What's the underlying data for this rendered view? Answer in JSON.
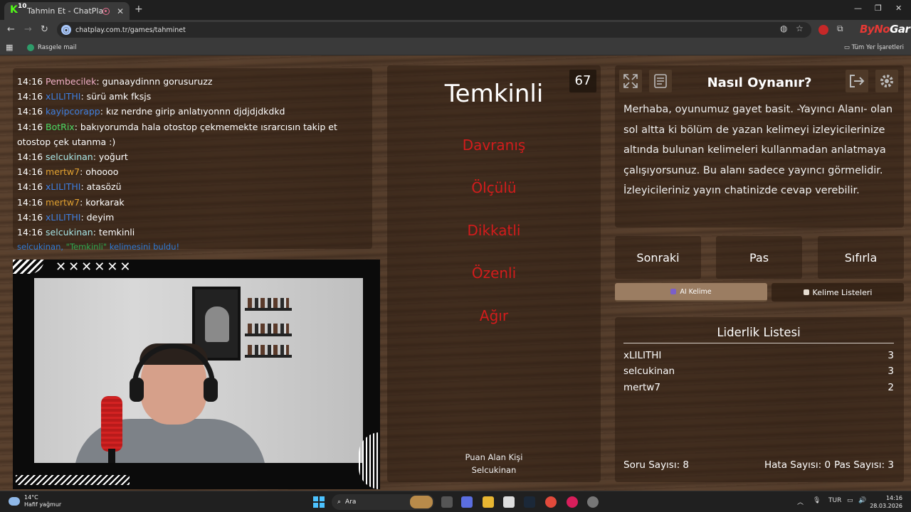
{
  "browser": {
    "tab_title": "Tahmin Et - ChatPlay",
    "tab_badge": "10",
    "url": "chatplay.com.tr/games/tahminet",
    "bookmark": "Rasgele mail",
    "all_bookmarks": "Tüm Yer İşaretleri",
    "brand_left": "ByNo",
    "brand_right": "Gar"
  },
  "chat": {
    "lines": [
      {
        "time": "14:16",
        "user": "Pembecilek",
        "color": "#f0b0c8",
        "text": ": gunaaydinnn gorusuruzz"
      },
      {
        "time": "14:16",
        "user": "xLILITHI",
        "color": "#3f7fe0",
        "text": ": sürü amk fksjs"
      },
      {
        "time": "14:16",
        "user": "kayipcorapp",
        "color": "#3f7fe0",
        "text": ": kız nerdne girip anlatıyonnn djdjdjdkdkd"
      },
      {
        "time": "14:16",
        "user": "BotRix",
        "color": "#4cd964",
        "text": ": bakıyorumda hala otostop çekmemekte ısrarcısın takip et otostop çek utanma :)"
      },
      {
        "time": "14:16",
        "user": "selcukinan",
        "color": "#a8e6e6",
        "text": ": yoğurt"
      },
      {
        "time": "14:16",
        "user": "mertw7",
        "color": "#e0a030",
        "text": ": ohoooo"
      },
      {
        "time": "14:16",
        "user": "xLILITHI",
        "color": "#3f7fe0",
        "text": ": atasözü"
      },
      {
        "time": "14:16",
        "user": "mertw7",
        "color": "#e0a030",
        "text": ": korkarak"
      },
      {
        "time": "14:16",
        "user": "xLILITHI",
        "color": "#3f7fe0",
        "text": ": deyim"
      },
      {
        "time": "14:16",
        "user": "selcukinan",
        "color": "#a8e6e6",
        "text": ": temkinli"
      }
    ],
    "system_prefix": "selcukinan, ",
    "system_word": "\"Temkinli\"",
    "system_suffix": " kelimesini buldu!"
  },
  "cam": {
    "overlay_marks": "✕✕✕✕✕✕"
  },
  "game": {
    "counter": "67",
    "main_word": "Temkinli",
    "forbidden": [
      "Davranış",
      "Ölçülü",
      "Dikkatli",
      "Özenli",
      "Ağır"
    ],
    "earner_label": "Puan Alan Kişi",
    "earner_name": "Selcukinan"
  },
  "howto": {
    "title": "Nasıl Oynanır?",
    "text": "Merhaba, oyunumuz gayet basit. -Yayıncı Alanı- olan sol altta ki bölüm de yazan kelimeyi izleyicilerinize altında bulunan kelimeleri kullanmadan anlatmaya çalışıyorsunuz. Bu alanı sadece yayıncı görmelidir. İzleyicileriniz yayın chatinizde cevap verebilir."
  },
  "actions": {
    "next": "Sonraki",
    "pass": "Pas",
    "reset": "Sıfırla"
  },
  "tabs": {
    "ai": "AI Kelime",
    "lists": "Kelime Listeleri"
  },
  "leaderboard": {
    "title": "Liderlik Listesi",
    "rows": [
      {
        "name": "xLILITHI",
        "score": "3"
      },
      {
        "name": "selcukinan",
        "score": "3"
      },
      {
        "name": "mertw7",
        "score": "2"
      }
    ],
    "questions": "Soru Sayısı: 8",
    "errors": "Hata Sayısı: 0",
    "passes": "Pas Sayısı: 3"
  },
  "taskbar": {
    "temp": "14°C",
    "weather": "Hafif yağmur",
    "search": "Ara",
    "lang": "TUR",
    "time": "14:16",
    "date": "28.03.2026"
  }
}
